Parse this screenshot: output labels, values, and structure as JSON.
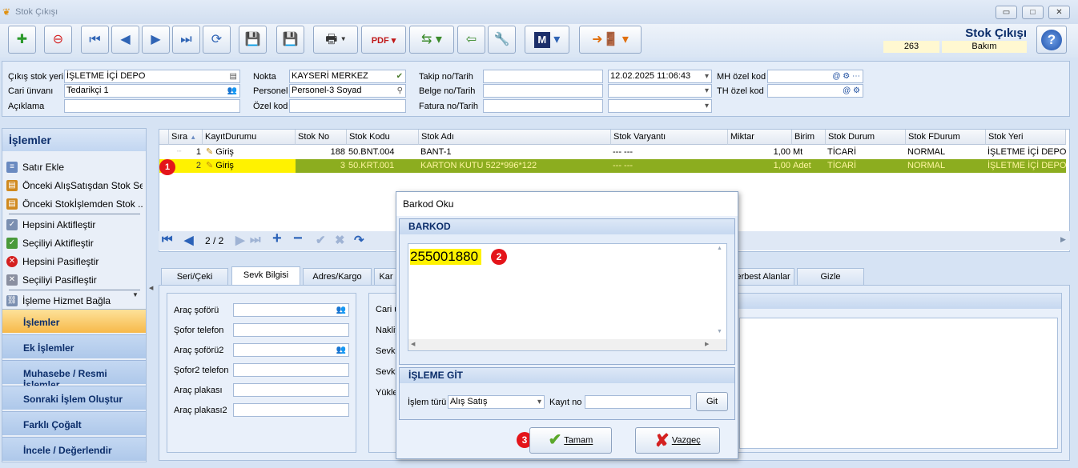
{
  "window": {
    "title": "Stok Çıkışı",
    "controls": [
      "▭",
      "□",
      "✕"
    ]
  },
  "toolbar": {
    "form_title": "Stok Çıkışı",
    "record_no": "263",
    "record_status": "Bakım",
    "buttons": [
      "new-record",
      "delete-record",
      "first",
      "previous",
      "next",
      "last",
      "refresh",
      "save",
      "cancel-save",
      "print",
      "pdf-export",
      "transfer",
      "import",
      "tools",
      "m-button",
      "exit"
    ]
  },
  "header": {
    "cikis_stok_yeri_label": "Çıkış stok yeri",
    "cikis_stok_yeri": "İŞLETME İÇİ DEPO",
    "cari_unvani_label": "Cari ünvanı",
    "cari_unvani": "Tedarikçi 1",
    "aciklama_label": "Açıklama",
    "aciklama": "",
    "nokta_label": "Nokta",
    "nokta": "KAYSERİ MERKEZ",
    "personel_label": "Personel",
    "personel": "Personel-3 Soyad",
    "ozel_kod_label": "Özel kod",
    "ozel_kod": "",
    "takip_label": "Takip no/Tarih",
    "takip_no": "",
    "takip_tarih": "12.02.2025 11:06:43",
    "belge_label": "Belge no/Tarih",
    "belge_no": "",
    "belge_tarih": "",
    "fatura_label": "Fatura no/Tarih",
    "fatura_no": "",
    "fatura_tarih": "",
    "mh_ozel_kod_label": "MH özel kod",
    "mh_ozel_kod": "",
    "th_ozel_kod_label": "TH özel kod",
    "th_ozel_kod": ""
  },
  "left_panel": {
    "title": "İşlemler",
    "operations": [
      "Satır Ekle",
      "Önceki AlışSatışdan Stok Seç",
      "Önceki Stokİşlemden Stok ...",
      "Hepsini Aktifleştir",
      "Seçiliyi Aktifleştir",
      "Hepsini Pasifleştir",
      "Seçiliyi Pasifleştir",
      "İşleme Hizmet Bağla"
    ],
    "sections": [
      "İşlemler",
      "Ek İşlemler",
      "Muhasebe / Resmi İşlemler",
      "Sonraki İşlem Oluştur",
      "Farklı Çoğalt",
      "İncele / Değerlendir"
    ]
  },
  "grid": {
    "columns": [
      "Sıra",
      "KayıtDurumu",
      "Stok No",
      "Stok Kodu",
      "Stok Adı",
      "Stok Varyantı",
      "Miktar",
      "Birim",
      "Stok Durum",
      "Stok FDurum",
      "Stok Yeri"
    ],
    "rows": [
      {
        "sira": "1",
        "durum": "Giriş",
        "stok_no": "188",
        "stok_kodu": "50.BNT.004",
        "stok_adi": "BANT-1",
        "varyant": "--- ---",
        "miktar": "1,00",
        "birim": "Mt",
        "stok_durum": "TİCARİ",
        "stok_fdurum": "NORMAL",
        "stok_yeri": "İŞLETME İÇİ DEPO"
      },
      {
        "sira": "2",
        "durum": "Giriş",
        "stok_no": "3",
        "stok_kodu": "50.KRT.001",
        "stok_adi": "KARTON KUTU 522*996*122",
        "varyant": "--- ---",
        "miktar": "1,00",
        "birim": "Adet",
        "stok_durum": "TİCARİ",
        "stok_fdurum": "NORMAL",
        "stok_yeri": "İŞLETME İÇİ DEPO"
      }
    ],
    "pager": "2 / 2"
  },
  "tabs": [
    "Seri/Çeki",
    "Sevk Bilgisi",
    "Adres/Kargo",
    "Kar",
    "erbest Alanlar",
    "Gizle"
  ],
  "sevk": {
    "labels": [
      "Araç şoförü",
      "Şofor telefon",
      "Araç şoförü2",
      "Şofor2 telefon",
      "Araç plakası",
      "Araç plakası2"
    ],
    "right_labels": [
      "Cari ü",
      "Nakliy",
      "Sevk",
      "Sevk",
      "Yükle"
    ]
  },
  "dialog": {
    "title": "Barkod Oku",
    "barkod_group": "BARKOD",
    "barcode_value": "255001880",
    "isleme_git_group": "İŞLEME GİT",
    "islem_turu_label": "İşlem türü",
    "islem_turu_value": "Alış Satış",
    "kayit_no_label": "Kayıt no",
    "kayit_no_value": "",
    "git_button": "Git",
    "ok_button": "Tamam",
    "cancel_button": "Vazgeç"
  },
  "badges": [
    "1",
    "2",
    "3"
  ],
  "colors": {
    "selected_row_bg": "#8cad1f",
    "selected_row_text": "#fff5a0",
    "highlight_yellow": "#fff200",
    "badge_red": "#e4141a",
    "accent_blue": "#0b2d6a"
  }
}
